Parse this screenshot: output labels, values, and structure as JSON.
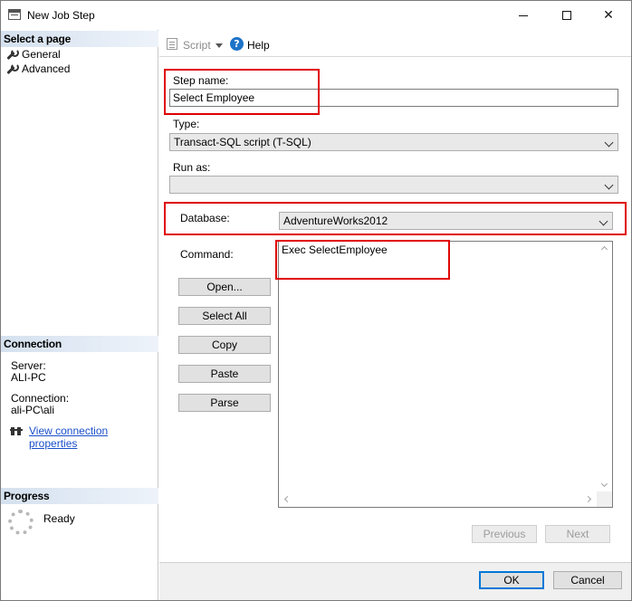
{
  "window": {
    "title": "New Job Step",
    "minimize_glyph": "",
    "close_glyph": "✕"
  },
  "left_pane": {
    "select_page_heading": "Select a page",
    "pages": [
      {
        "label": "General",
        "icon": "wrench-icon"
      },
      {
        "label": "Advanced",
        "icon": "wrench-icon"
      }
    ],
    "connection_heading": "Connection",
    "server_label": "Server:",
    "server_value": "ALI-PC",
    "connection_label": "Connection:",
    "connection_value": "ali-PC\\ali",
    "view_connection_link": "View connection properties",
    "progress_heading": "Progress",
    "progress_status": "Ready"
  },
  "toolbar": {
    "script_label": "Script",
    "help_label": "Help",
    "help_glyph": "?"
  },
  "form": {
    "step_name_label": "Step name:",
    "step_name_value": "Select Employee",
    "type_label": "Type:",
    "type_value": "Transact-SQL script (T-SQL)",
    "run_as_label": "Run as:",
    "run_as_value": "",
    "database_label": "Database:",
    "database_value": "AdventureWorks2012",
    "command_label": "Command:",
    "command_value": "Exec SelectEmployee"
  },
  "command_buttons": {
    "open": "Open...",
    "select_all": "Select All",
    "copy": "Copy",
    "paste": "Paste",
    "parse": "Parse"
  },
  "nav_buttons": {
    "previous": "Previous",
    "next": "Next"
  },
  "dialog_buttons": {
    "ok": "OK",
    "cancel": "Cancel"
  },
  "colors": {
    "highlight_box": "#e00000",
    "link": "#1a4fc8",
    "section_header": "#d5e1ef",
    "primary_border": "#0078d7"
  }
}
